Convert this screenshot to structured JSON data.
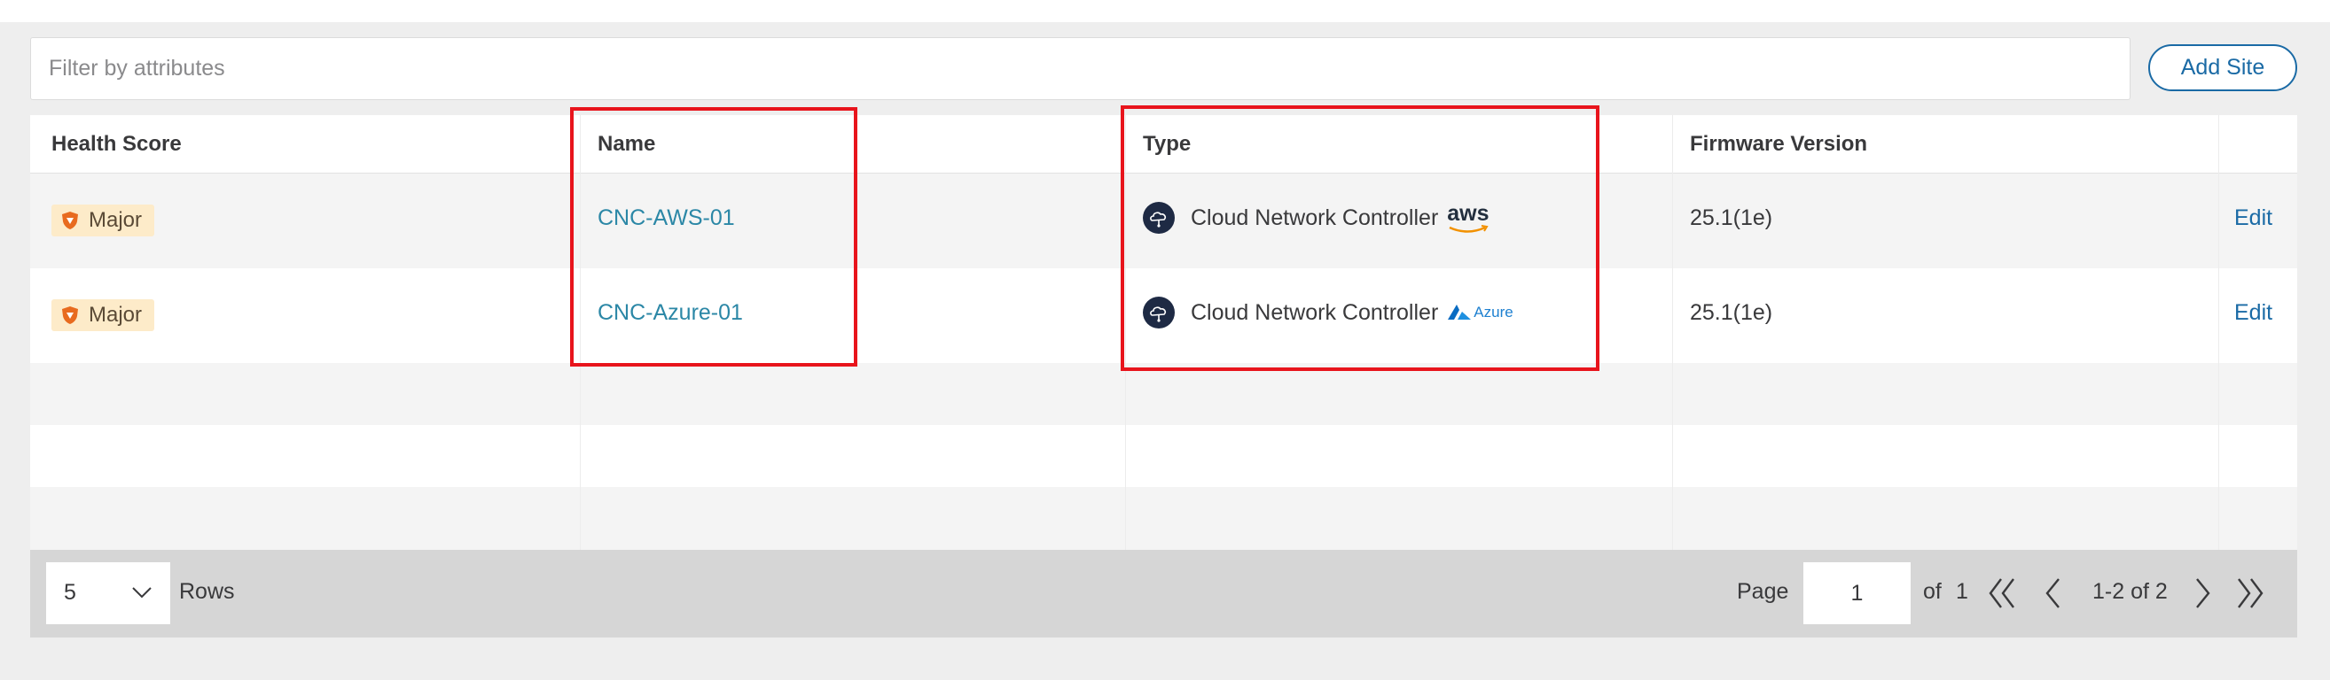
{
  "filter": {
    "placeholder": "Filter by attributes"
  },
  "actions": {
    "add_site_label": "Add Site"
  },
  "table": {
    "columns": [
      "Health Score",
      "Name",
      "Type",
      "Firmware Version"
    ],
    "rows": [
      {
        "health": "Major",
        "name": "CNC-AWS-01",
        "type": "Cloud Network Controller",
        "vendor_icon": "aws-logo-icon",
        "vendor_text": "aws",
        "firmware": "25.1(1e)",
        "action": "Edit"
      },
      {
        "health": "Major",
        "name": "CNC-Azure-01",
        "type": "Cloud Network Controller",
        "vendor_icon": "azure-logo-icon",
        "vendor_text": "Azure",
        "firmware": "25.1(1e)",
        "action": "Edit"
      }
    ]
  },
  "pagination": {
    "rows_per_page": "5",
    "rows_label": "Rows",
    "page_label": "Page",
    "current_page": "1",
    "of_label": "of",
    "total_pages": "1",
    "range": "1-2 of 2"
  },
  "colors": {
    "accent": "#1a6aa5",
    "link": "#2b87a6",
    "major_badge_bg": "#fdebc9",
    "major_icon": "#e86b1f",
    "highlight": "#e8141c"
  }
}
